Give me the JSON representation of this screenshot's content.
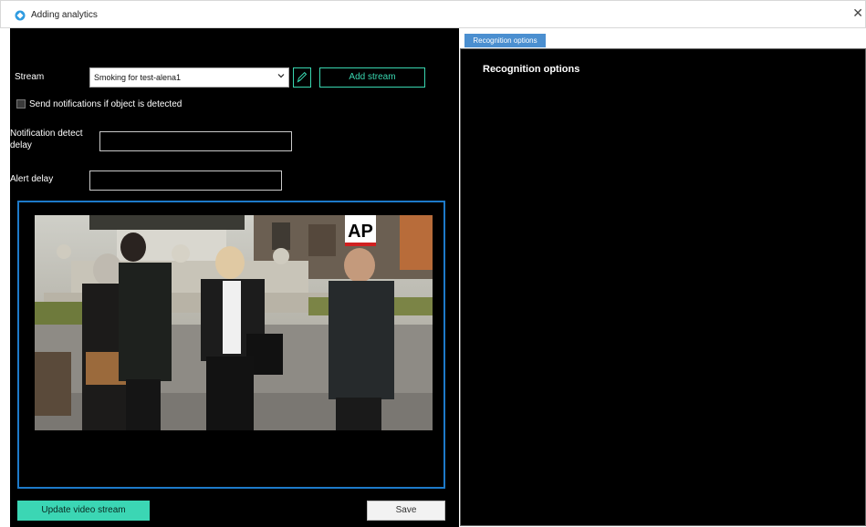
{
  "window": {
    "title": "Adding analytics",
    "close_glyph": "✕"
  },
  "form": {
    "stream_label": "Stream",
    "stream_selected": "Smoking for test-alena1",
    "add_stream_label": "Add stream",
    "notify_checkbox_label": "Send notifications if object is detected",
    "notify_checked": false,
    "notification_delay_label": "Notification detect delay",
    "notification_delay_value": "",
    "alert_delay_label": "Alert delay",
    "alert_delay_value": ""
  },
  "video": {
    "watermark": "AP"
  },
  "actions": {
    "update_label": "Update video stream",
    "save_label": "Save"
  },
  "recognition": {
    "tab_label": "Recognition options",
    "panel_title": "Recognition options"
  },
  "colors": {
    "accent": "#39d6b0",
    "video_border": "#1d7ac9",
    "tab_active": "#4b8fd0"
  },
  "icons": [
    "app-logo-icon",
    "close-icon",
    "chevron-down-icon",
    "pencil-icon"
  ]
}
